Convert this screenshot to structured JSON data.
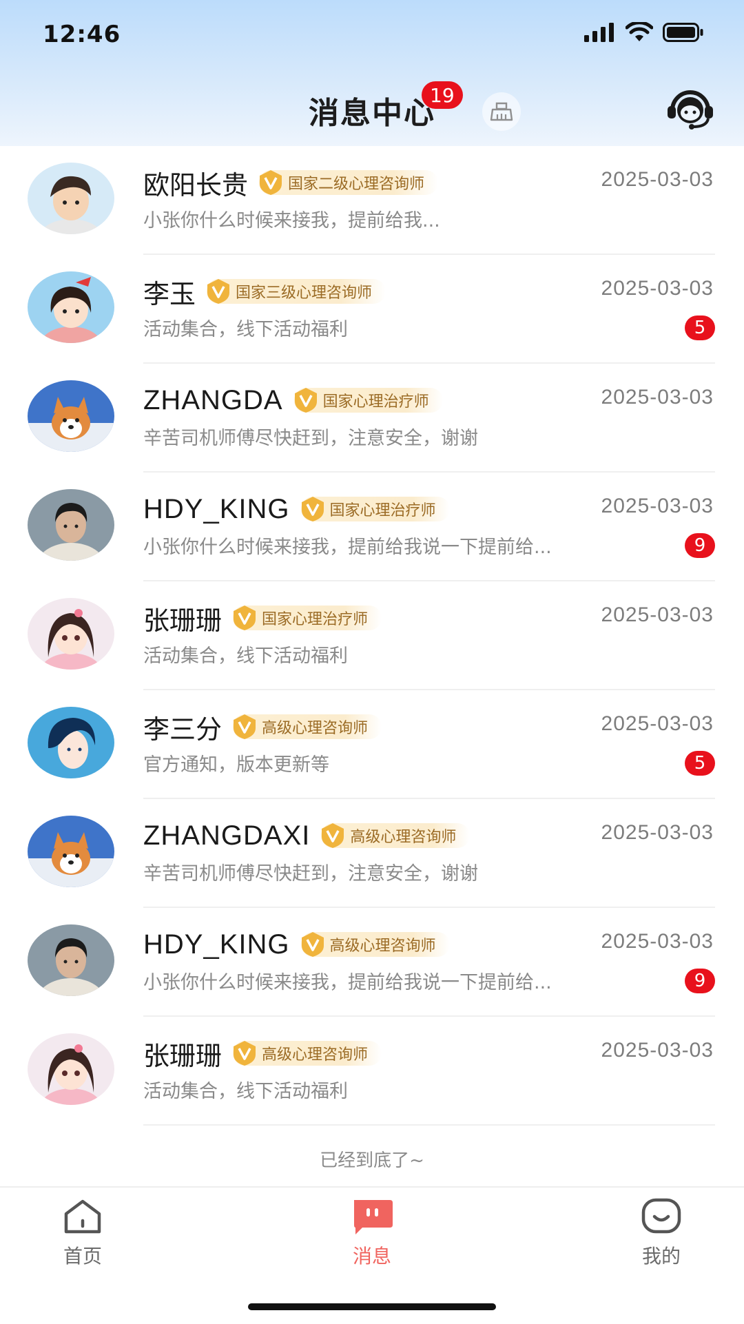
{
  "status_bar": {
    "time": "12:46"
  },
  "header": {
    "title": "消息中心",
    "badge": "19",
    "icons": {
      "clear": "broom-icon",
      "service": "headset-icon"
    }
  },
  "conversations": [
    {
      "name": "欧阳长贵",
      "cert": "国家二级心理咨询师",
      "date": "2025-03-03",
      "preview": "小张你什么时候来接我，提前给我...",
      "unread": "",
      "avatar": "boy-cartoon"
    },
    {
      "name": "李玉",
      "cert": "国家三级心理咨询师",
      "date": "2025-03-03",
      "preview": "活动集合，线下活动福利",
      "unread": "5",
      "avatar": "girl-cartoon"
    },
    {
      "name": "ZHANGDA",
      "cert": "国家心理治疗师",
      "date": "2025-03-03",
      "preview": "辛苦司机师傅尽快赶到，注意安全，谢谢",
      "unread": "",
      "avatar": "corgi"
    },
    {
      "name": "HDY_KING",
      "cert": "国家心理治疗师",
      "date": "2025-03-03",
      "preview": "小张你什么时候来接我，提前给我说一下提前给...",
      "unread": "9",
      "avatar": "young-man"
    },
    {
      "name": "张珊珊",
      "cert": "国家心理治疗师",
      "date": "2025-03-03",
      "preview": "活动集合，线下活动福利",
      "unread": "",
      "avatar": "anime-girl"
    },
    {
      "name": "李三分",
      "cert": "高级心理咨询师",
      "date": "2025-03-03",
      "preview": "官方通知，版本更新等",
      "unread": "5",
      "avatar": "anime-boy"
    },
    {
      "name": "ZHANGDAXI",
      "cert": "高级心理咨询师",
      "date": "2025-03-03",
      "preview": "辛苦司机师傅尽快赶到，注意安全，谢谢",
      "unread": "",
      "avatar": "corgi"
    },
    {
      "name": "HDY_KING",
      "cert": "高级心理咨询师",
      "date": "2025-03-03",
      "preview": "小张你什么时候来接我，提前给我说一下提前给...",
      "unread": "9",
      "avatar": "young-man"
    },
    {
      "name": "张珊珊",
      "cert": "高级心理咨询师",
      "date": "2025-03-03",
      "preview": "活动集合，线下活动福利",
      "unread": "",
      "avatar": "anime-girl"
    }
  ],
  "end_text": "已经到底了~",
  "tabbar": {
    "items": [
      {
        "label": "首页",
        "icon": "home-icon",
        "active": false
      },
      {
        "label": "消息",
        "icon": "message-icon",
        "active": true
      },
      {
        "label": "我的",
        "icon": "profile-icon",
        "active": false
      }
    ]
  },
  "colors": {
    "accent": "#f0645f",
    "badge": "#e8111c",
    "cert_text": "#9b6b25",
    "header_top": "#bcdcfb"
  }
}
